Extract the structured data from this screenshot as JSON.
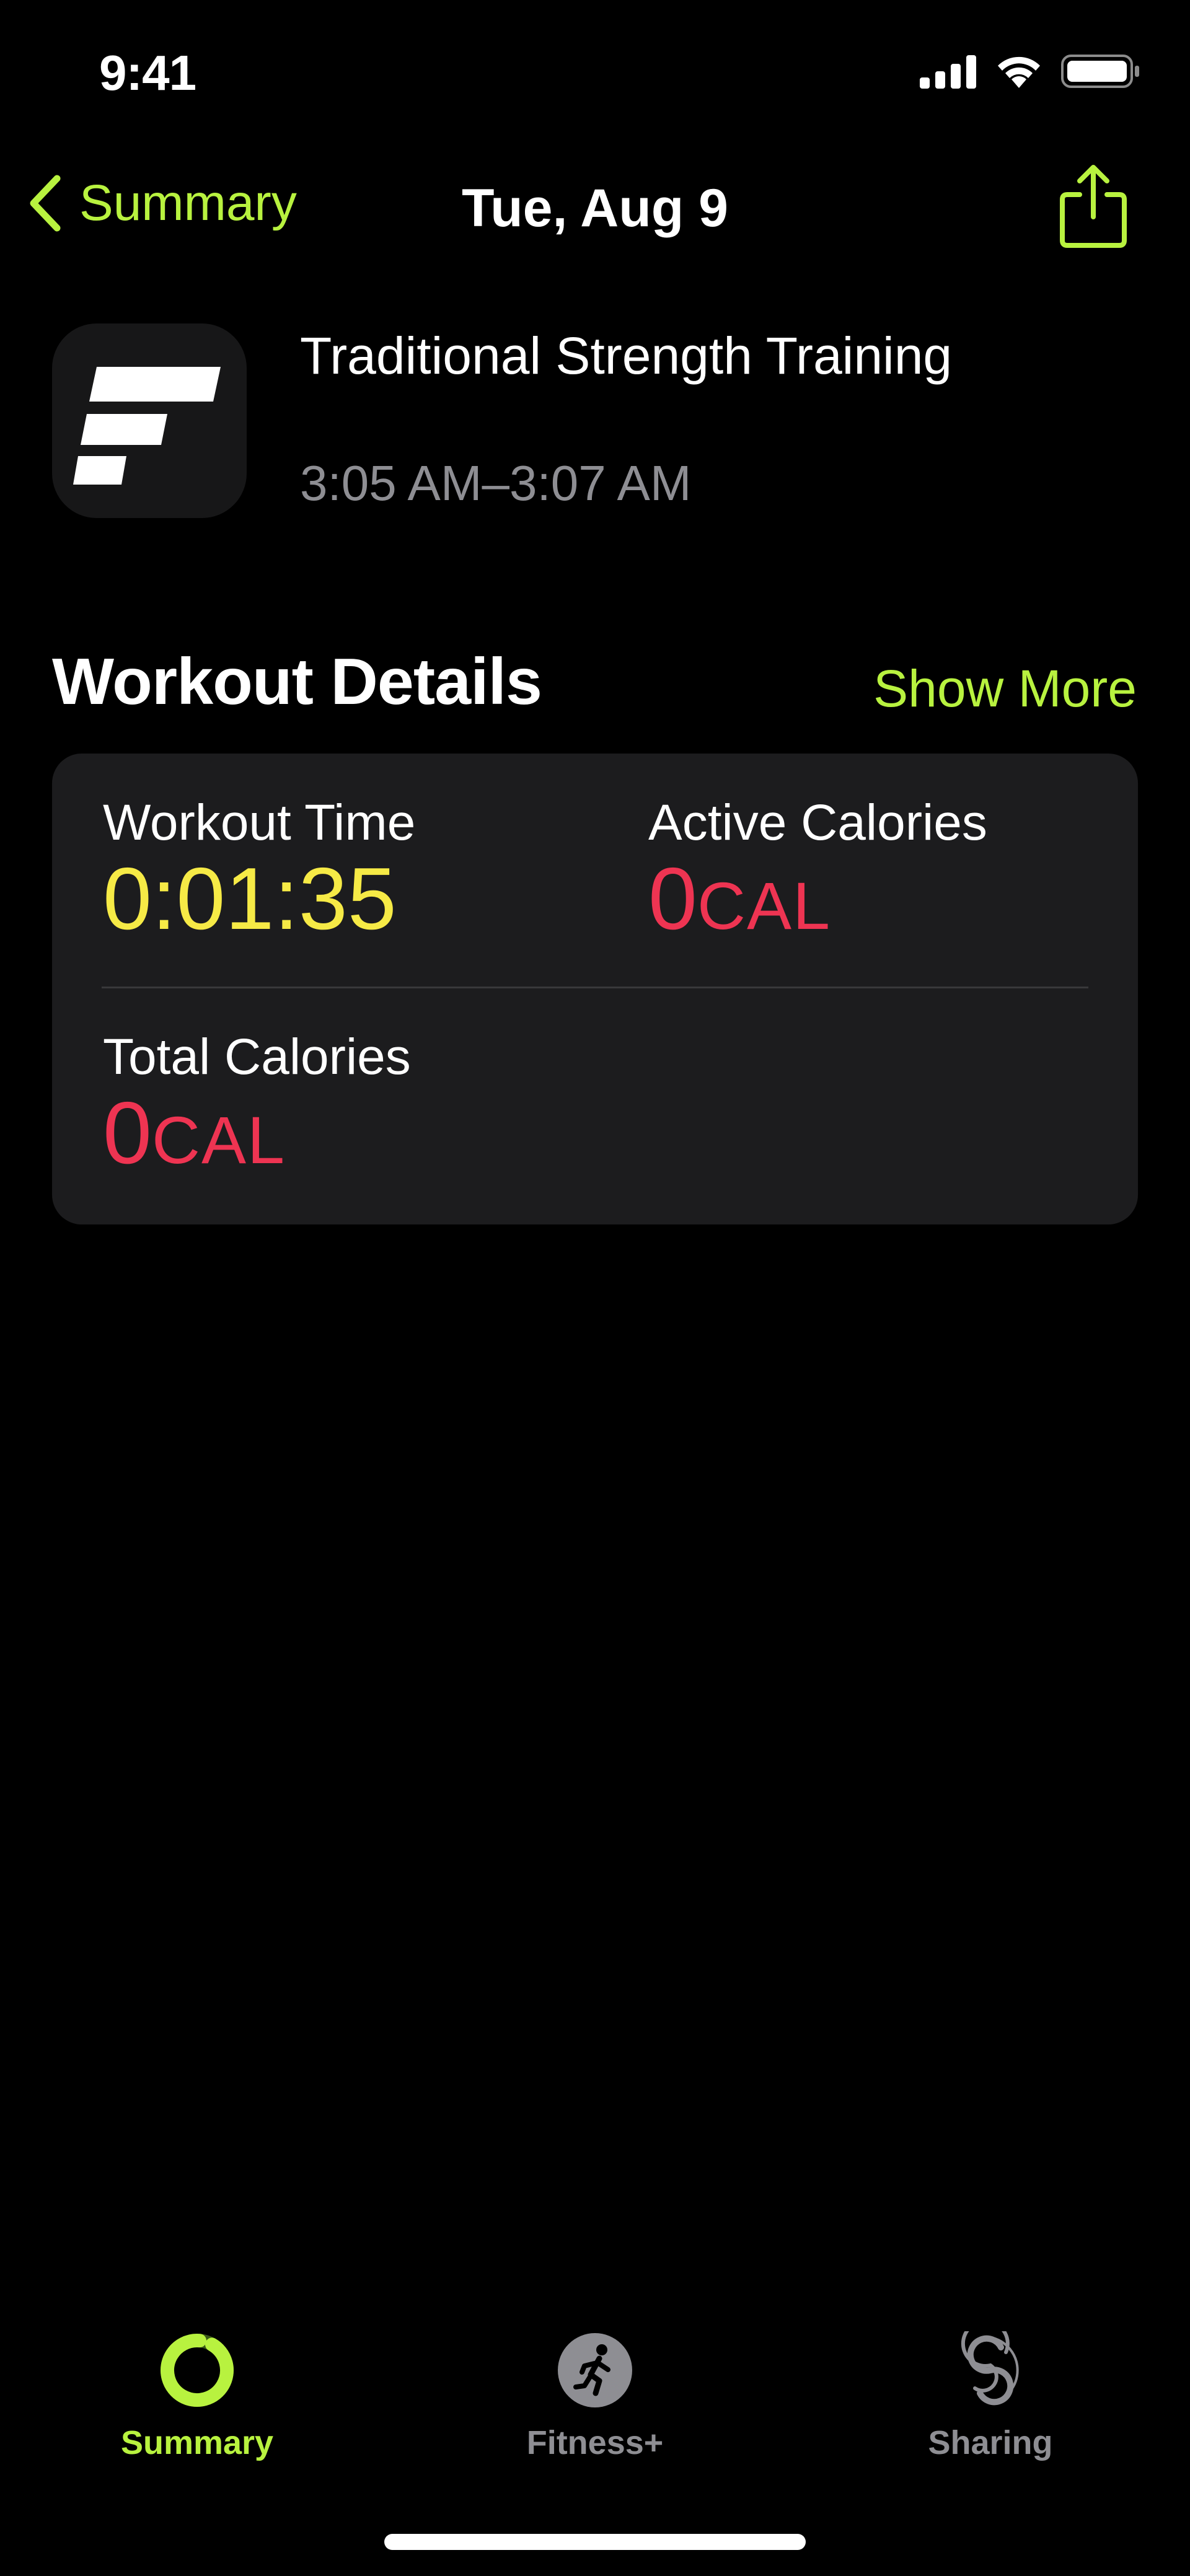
{
  "status_bar": {
    "time": "9:41",
    "icons": [
      "cellular-signal-icon",
      "wifi-icon",
      "battery-icon"
    ]
  },
  "nav": {
    "back_label": "Summary",
    "title": "Tue, Aug 9",
    "share_icon": "share-icon"
  },
  "workout": {
    "app_icon": "fitness-app-logo",
    "name": "Traditional Strength Training",
    "time_range": "3:05 AM–3:07 AM"
  },
  "details": {
    "title": "Workout Details",
    "show_more": "Show More",
    "metrics": [
      {
        "label": "Workout Time",
        "value": "0:01:35",
        "unit": "",
        "color": "#f6ea46"
      },
      {
        "label": "Active Calories",
        "value": "0",
        "unit": "CAL",
        "color": "#ee3452"
      },
      {
        "label": "Total Calories",
        "value": "0",
        "unit": "CAL",
        "color": "#ee3452"
      }
    ]
  },
  "tab_bar": {
    "tabs": [
      {
        "label": "Summary",
        "icon": "activity-ring-icon",
        "active": true
      },
      {
        "label": "Fitness+",
        "icon": "running-figure-icon",
        "active": false
      },
      {
        "label": "Sharing",
        "icon": "sharing-icon",
        "active": false
      }
    ]
  },
  "colors": {
    "accent": "#b8f23f",
    "background": "#000000",
    "card": "#1c1c1e",
    "secondary_text": "#8e8e93",
    "yellow_metric": "#f6ea46",
    "red_metric": "#ee3452"
  }
}
